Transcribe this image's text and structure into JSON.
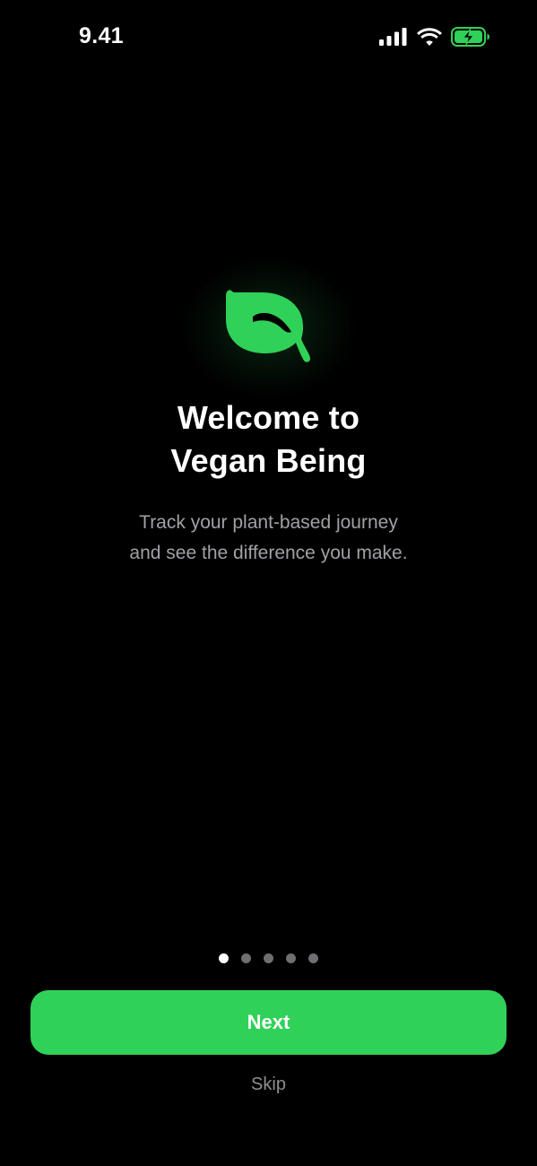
{
  "status_bar": {
    "time": "9.41",
    "icons": [
      "cellular-signal-icon",
      "wifi-icon",
      "battery-charging-icon"
    ]
  },
  "hero": {
    "icon": "leaf-icon",
    "title_lines": [
      "Welcome to",
      "Vegan Being"
    ],
    "subtitle_lines": [
      "Track your plant-based journey",
      "and see the difference you make."
    ]
  },
  "pagination": {
    "total": 5,
    "current": 1
  },
  "actions": {
    "next_label": "Next",
    "skip_label": "Skip"
  },
  "colors": {
    "background": "#000000",
    "accent": "#30d158",
    "text_primary": "#ffffff",
    "text_secondary": "#a1a1a6",
    "text_tertiary": "#8e8e93"
  }
}
